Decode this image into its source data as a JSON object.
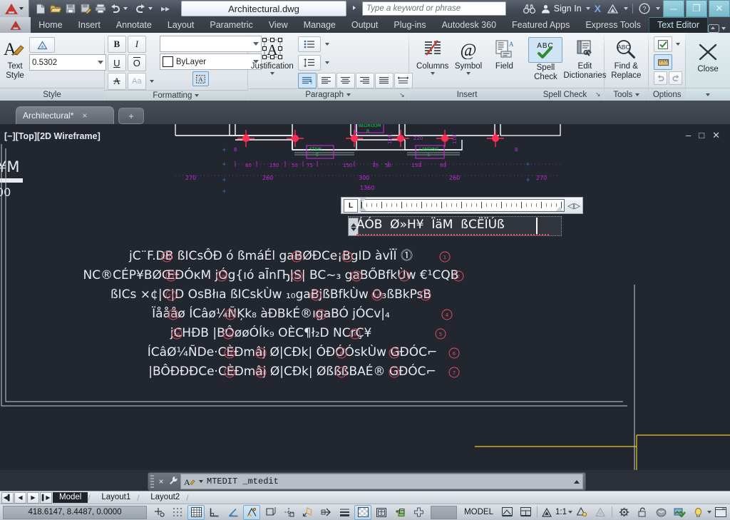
{
  "titlebar": {
    "app_icon": "autocad-a-logo",
    "quick_access": [
      {
        "name": "new-icon",
        "label": "New"
      },
      {
        "name": "open-icon",
        "label": "Open"
      },
      {
        "name": "save-icon",
        "label": "Save"
      },
      {
        "name": "saveas-icon",
        "label": "Save As"
      },
      {
        "name": "plot-icon",
        "label": "Plot"
      },
      {
        "name": "undo-icon",
        "label": "Undo"
      },
      {
        "name": "redo-icon",
        "label": "Redo"
      },
      {
        "name": "more-icon",
        "label": "More"
      }
    ],
    "document_title": "Architectural.dwg",
    "search_placeholder": "Type a keyword or phrase",
    "search_value": "",
    "binoculars_icon": "binoculars-icon",
    "sign_in": "Sign In",
    "exchange_icon": "autodesk-exchange-icon",
    "help_icon": "help-icon",
    "window_buttons": [
      "minimize",
      "restore",
      "close"
    ]
  },
  "ribbon_tabs": {
    "items": [
      {
        "label": "Home",
        "active": false
      },
      {
        "label": "Insert",
        "active": false
      },
      {
        "label": "Annotate",
        "active": false
      },
      {
        "label": "Layout",
        "active": false
      },
      {
        "label": "Parametric",
        "active": false
      },
      {
        "label": "View",
        "active": false
      },
      {
        "label": "Manage",
        "active": false
      },
      {
        "label": "Output",
        "active": false
      },
      {
        "label": "Plug-ins",
        "active": false
      },
      {
        "label": "Autodesk 360",
        "active": false
      },
      {
        "label": "Featured Apps",
        "active": false
      },
      {
        "label": "Express Tools",
        "active": false
      },
      {
        "label": "Text Editor",
        "active": true
      }
    ]
  },
  "ribbon": {
    "panels": [
      {
        "title": "Style",
        "text_style_label": "Text\nStyle",
        "annotative_icon": "annotative-icon",
        "height_value": "0.5302"
      },
      {
        "title": "Formatting",
        "bold": "B",
        "italic": "I",
        "underline": "U",
        "overline": "O",
        "strikethrough_icon": "strikethrough-icon",
        "case_label": "Aa",
        "font_value": "",
        "color_value": "ByLayer",
        "color_swatch": "#ffffff",
        "background_mask_icon": "background-mask-icon"
      },
      {
        "title": "Paragraph",
        "justification_label": "Justification",
        "bullets_icon": "bullets-numbering-icon",
        "line_spacing_icon": "line-spacing-icon",
        "align_buttons": [
          "paragraph-align-icon",
          "align-left-icon",
          "align-center-icon",
          "align-right-icon",
          "align-justify-icon",
          "align-distributed-icon"
        ],
        "active_align_index": 0
      },
      {
        "title": "Insert",
        "columns_label": "Columns",
        "symbol_label": "Symbol",
        "field_label": "Field"
      },
      {
        "title": "Spell Check",
        "spell_check_label": "Spell\nCheck",
        "spell_check_active": true,
        "edit_dictionaries_label": "Edit\nDictionaries"
      },
      {
        "title": "Tools",
        "find_replace_label": "Find &\nReplace"
      },
      {
        "title": "Options",
        "more_options_icon": "checked-options-icon",
        "ruler_icon": "ruler-icon",
        "ruler_active": true,
        "undo_icon": "undo-icon",
        "redo_icon": "redo-icon"
      },
      {
        "title": "Close",
        "close_label": "Close",
        "close_icon": "close-x-icon"
      }
    ]
  },
  "doc_tabs": {
    "tabs": [
      {
        "label": "Architectural*",
        "modified": true
      }
    ],
    "close_glyph": "×",
    "add_glyph": "+"
  },
  "canvas": {
    "viewport_label": "[−][Top][2D Wireframe]",
    "ucs_fragment_left": "¥M",
    "ucs_fragment_bottom": "00",
    "minimize_glyph": "–",
    "restore_glyph": "□",
    "close_glyph": "✕",
    "dimension_texts_row1": [
      "60",
      "150",
      "50",
      "75",
      "150",
      "75",
      "50",
      "150",
      "60"
    ],
    "dimension_texts_row2": [
      "270",
      "260",
      "300",
      "260",
      "270"
    ],
    "dimension_texts_row3": [
      "1360"
    ],
    "small_dim_texts": [
      "110",
      "220",
      "110"
    ],
    "mtext_lines": [
      "jC¨F.DB  ßICsÔÐ  ó  ßmáÉl  gaBØÐCe¡BgID        àvÏÏ  ⓵",
      "NC®CÉP¥BØŒÐÓĸM  jÓg{ıó  aĪnҦ|S|  BC~₃ gaBŐBfkÙw €¹CQB",
      "ßICs  ×¢|C|D        OsBłıa       ßICskÙw ₁₀gaBjßBfkÙw  O₃ßBkPsB",
      "Ïåååø       ÍCâø¼ÑĶk₈       àÐBkÉ®ıgaBÓ        jÓCv|₄",
      "jCHÐB     |BÔøøÓÍk₉          OÈC¶ł₂D           NCrÇ¥",
      "ÍCâØ¼ÑDe·CÈÐmâj  Ø|CÐk| ÓÐÓÓskÙw  GÐÓC⌐",
      "|BÔÐÐÐCe·CÈÐmâj  Ø|CÐk|  ØßßßBAÉ® GÐÓC⌐"
    ]
  },
  "text_editor": {
    "ruler_left_tab_glyph": "L",
    "ruler_arrow_left": "◁",
    "ruler_arrow_right": "▷",
    "edit_text": "ÁÓB  Ø»H¥  ÏäM  ßCËÏÚß",
    "cursor_visible": true,
    "spell_underline": true
  },
  "command_line": {
    "close_glyph": "×",
    "settings_icon": "wrench-icon",
    "prompt_icon": "command-prompt-icon",
    "text": "MTEDIT _mtedit",
    "expand_glyph": "▲"
  },
  "layout_tabs": {
    "nav": [
      "first-layout-icon",
      "prev-layout-icon",
      "next-layout-icon",
      "last-layout-icon"
    ],
    "tabs": [
      {
        "label": "Model",
        "active": true
      },
      {
        "label": "Layout1",
        "active": false
      },
      {
        "label": "Layout2",
        "active": false
      }
    ]
  },
  "status_bar": {
    "coordinates": "418.6147, 8.4487, 0.0000",
    "toggles": [
      {
        "name": "infer-constraints-icon",
        "on": false
      },
      {
        "name": "snap-mode-icon",
        "on": false
      },
      {
        "name": "grid-display-icon",
        "on": true
      },
      {
        "name": "ortho-mode-icon",
        "on": false
      },
      {
        "name": "polar-tracking-icon",
        "on": false
      },
      {
        "name": "object-snap-icon",
        "on": false
      },
      {
        "name": "3d-object-snap-icon",
        "on": false
      },
      {
        "name": "object-snap-tracking-icon",
        "on": true
      },
      {
        "name": "dynamic-ucs-icon",
        "on": true
      },
      {
        "name": "dynamic-input-icon",
        "on": false
      },
      {
        "name": "lineweight-icon",
        "on": false
      },
      {
        "name": "transparency-icon",
        "on": true
      },
      {
        "name": "quick-properties-icon",
        "on": false
      },
      {
        "name": "selection-cycling-icon",
        "on": false
      },
      {
        "name": "annotation-monitor-icon",
        "on": false
      }
    ],
    "space_label": "MODEL",
    "layout_icons": [
      "model-space-icon",
      "viewport-icon"
    ],
    "annotation_scale": "1:1",
    "annotation_visibility_icon": "annotation-visibility-icon",
    "auto_scale_icon": "auto-add-scale-icon",
    "workspace_icon": "workspace-gear-icon",
    "lock_icon": "toolbar-lock-icon",
    "hardware_icon": "hardware-accel-icon",
    "isolate_icon": "isolate-objects-icon",
    "clean_screen_icon": "clean-screen-icon",
    "expand_icon": "status-expand-icon"
  }
}
